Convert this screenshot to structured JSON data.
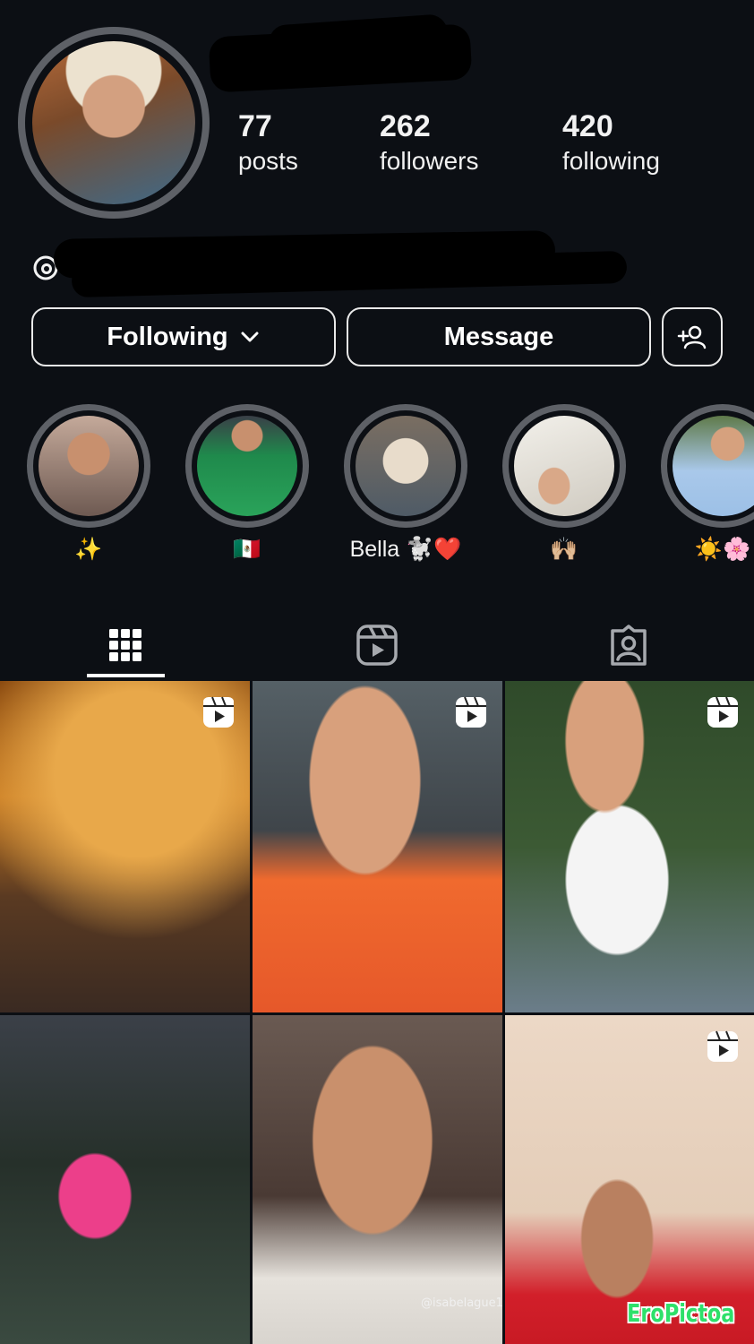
{
  "profile": {
    "stats": [
      {
        "value": "77",
        "label": "posts"
      },
      {
        "value": "262",
        "label": "followers"
      },
      {
        "value": "420",
        "label": "following"
      }
    ]
  },
  "actions": {
    "following_label": "Following",
    "message_label": "Message"
  },
  "highlights": [
    {
      "label": "✨"
    },
    {
      "label": "🇲🇽"
    },
    {
      "label": "Bella 🐩❤️"
    },
    {
      "label": "🙌🏼"
    },
    {
      "label": "☀️🌸"
    }
  ],
  "tabs": [
    {
      "icon": "grid-icon",
      "active": true
    },
    {
      "icon": "reels-icon",
      "active": false
    },
    {
      "icon": "tagged-icon",
      "active": false
    }
  ],
  "grid": {
    "tile5_caption": "@isabelague1"
  },
  "watermark": "EroPictoa",
  "colors": {
    "background": "#0c0f14",
    "ring": "#5e6167",
    "text": "#f2f2f2",
    "watermark": "#2ee06a"
  }
}
